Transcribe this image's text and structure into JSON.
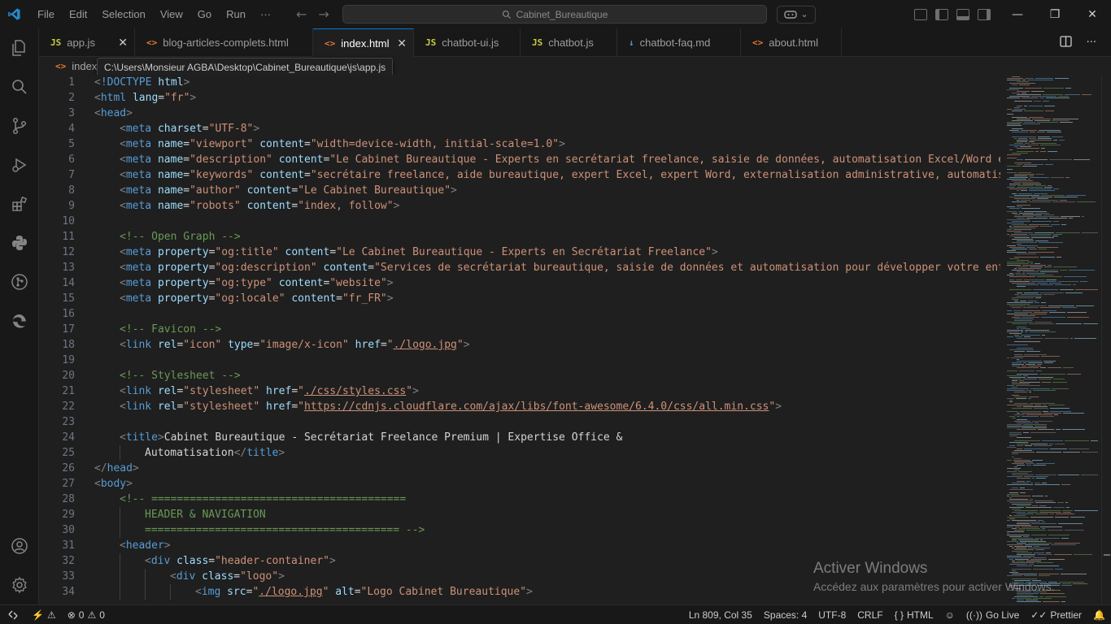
{
  "menu": [
    "File",
    "Edit",
    "Selection",
    "View",
    "Go",
    "Run",
    "···"
  ],
  "search_box": "Cabinet_Bureautique",
  "tabs": [
    {
      "label": "app.js",
      "type": "js",
      "width": 118
    },
    {
      "label": "blog-articles-complets.html",
      "type": "html",
      "width": 219
    },
    {
      "label": "index.html",
      "type": "html",
      "width": 124,
      "active": true
    },
    {
      "label": "chatbot-ui.js",
      "type": "js",
      "width": 131
    },
    {
      "label": "chatbot.js",
      "type": "js",
      "width": 119
    },
    {
      "label": "chatbot-faq.md",
      "type": "md",
      "width": 152
    },
    {
      "label": "about.html",
      "type": "html",
      "width": 124
    }
  ],
  "breadcrumb": "index.",
  "tooltip": "C:\\Users\\Monsieur AGBA\\Desktop\\Cabinet_Bureautique\\js\\app.js",
  "code_lines": [
    {
      "n": 1,
      "i": 0,
      "t": [
        [
          "b",
          "<"
        ],
        [
          "tg",
          "!DOCTYPE"
        ],
        [
          "tx",
          " "
        ],
        [
          "at",
          "html"
        ],
        [
          "b",
          ">"
        ]
      ]
    },
    {
      "n": 2,
      "i": 0,
      "t": [
        [
          "b",
          "<"
        ],
        [
          "tg",
          "html"
        ],
        [
          "tx",
          " "
        ],
        [
          "at",
          "lang"
        ],
        [
          "tx",
          "="
        ],
        [
          "st",
          "\"fr\""
        ],
        [
          "b",
          ">"
        ]
      ]
    },
    {
      "n": 3,
      "i": 0,
      "t": [
        [
          "b",
          "<"
        ],
        [
          "tg",
          "head"
        ],
        [
          "b",
          ">"
        ]
      ]
    },
    {
      "n": 4,
      "i": 1,
      "t": [
        [
          "b",
          "<"
        ],
        [
          "tg",
          "meta"
        ],
        [
          "tx",
          " "
        ],
        [
          "at",
          "charset"
        ],
        [
          "tx",
          "="
        ],
        [
          "st",
          "\"UTF-8\""
        ],
        [
          "b",
          ">"
        ]
      ]
    },
    {
      "n": 5,
      "i": 1,
      "t": [
        [
          "b",
          "<"
        ],
        [
          "tg",
          "meta"
        ],
        [
          "tx",
          " "
        ],
        [
          "at",
          "name"
        ],
        [
          "tx",
          "="
        ],
        [
          "st",
          "\"viewport\""
        ],
        [
          "tx",
          " "
        ],
        [
          "at",
          "content"
        ],
        [
          "tx",
          "="
        ],
        [
          "st",
          "\"width=device-width, initial-scale=1.0\""
        ],
        [
          "b",
          ">"
        ]
      ]
    },
    {
      "n": 6,
      "i": 1,
      "t": [
        [
          "b",
          "<"
        ],
        [
          "tg",
          "meta"
        ],
        [
          "tx",
          " "
        ],
        [
          "at",
          "name"
        ],
        [
          "tx",
          "="
        ],
        [
          "st",
          "\"description\""
        ],
        [
          "tx",
          " "
        ],
        [
          "at",
          "content"
        ],
        [
          "tx",
          "="
        ],
        [
          "st",
          "\"Le Cabinet Bureautique - Experts en secrétariat freelance, saisie de données, automatisation Excel/Word et"
        ]
      ]
    },
    {
      "n": 7,
      "i": 1,
      "t": [
        [
          "b",
          "<"
        ],
        [
          "tg",
          "meta"
        ],
        [
          "tx",
          " "
        ],
        [
          "at",
          "name"
        ],
        [
          "tx",
          "="
        ],
        [
          "st",
          "\"keywords\""
        ],
        [
          "tx",
          " "
        ],
        [
          "at",
          "content"
        ],
        [
          "tx",
          "="
        ],
        [
          "st",
          "\"secrétaire freelance, aide bureautique, expert Excel, expert Word, externalisation administrative, automatisat"
        ]
      ]
    },
    {
      "n": 8,
      "i": 1,
      "t": [
        [
          "b",
          "<"
        ],
        [
          "tg",
          "meta"
        ],
        [
          "tx",
          " "
        ],
        [
          "at",
          "name"
        ],
        [
          "tx",
          "="
        ],
        [
          "st",
          "\"author\""
        ],
        [
          "tx",
          " "
        ],
        [
          "at",
          "content"
        ],
        [
          "tx",
          "="
        ],
        [
          "st",
          "\"Le Cabinet Bureautique\""
        ],
        [
          "b",
          ">"
        ]
      ]
    },
    {
      "n": 9,
      "i": 1,
      "t": [
        [
          "b",
          "<"
        ],
        [
          "tg",
          "meta"
        ],
        [
          "tx",
          " "
        ],
        [
          "at",
          "name"
        ],
        [
          "tx",
          "="
        ],
        [
          "st",
          "\"robots\""
        ],
        [
          "tx",
          " "
        ],
        [
          "at",
          "content"
        ],
        [
          "tx",
          "="
        ],
        [
          "st",
          "\"index, follow\""
        ],
        [
          "b",
          ">"
        ]
      ]
    },
    {
      "n": 10,
      "i": 1,
      "t": []
    },
    {
      "n": 11,
      "i": 1,
      "t": [
        [
          "cm",
          "<!-- Open Graph -->"
        ]
      ]
    },
    {
      "n": 12,
      "i": 1,
      "t": [
        [
          "b",
          "<"
        ],
        [
          "tg",
          "meta"
        ],
        [
          "tx",
          " "
        ],
        [
          "at",
          "property"
        ],
        [
          "tx",
          "="
        ],
        [
          "st",
          "\"og:title\""
        ],
        [
          "tx",
          " "
        ],
        [
          "at",
          "content"
        ],
        [
          "tx",
          "="
        ],
        [
          "st",
          "\"Le Cabinet Bureautique - Experts en Secrétariat Freelance\""
        ],
        [
          "b",
          ">"
        ]
      ]
    },
    {
      "n": 13,
      "i": 1,
      "t": [
        [
          "b",
          "<"
        ],
        [
          "tg",
          "meta"
        ],
        [
          "tx",
          " "
        ],
        [
          "at",
          "property"
        ],
        [
          "tx",
          "="
        ],
        [
          "st",
          "\"og:description\""
        ],
        [
          "tx",
          " "
        ],
        [
          "at",
          "content"
        ],
        [
          "tx",
          "="
        ],
        [
          "st",
          "\"Services de secrétariat bureautique, saisie de données et automatisation pour développer votre entre"
        ]
      ]
    },
    {
      "n": 14,
      "i": 1,
      "t": [
        [
          "b",
          "<"
        ],
        [
          "tg",
          "meta"
        ],
        [
          "tx",
          " "
        ],
        [
          "at",
          "property"
        ],
        [
          "tx",
          "="
        ],
        [
          "st",
          "\"og:type\""
        ],
        [
          "tx",
          " "
        ],
        [
          "at",
          "content"
        ],
        [
          "tx",
          "="
        ],
        [
          "st",
          "\"website\""
        ],
        [
          "b",
          ">"
        ]
      ]
    },
    {
      "n": 15,
      "i": 1,
      "t": [
        [
          "b",
          "<"
        ],
        [
          "tg",
          "meta"
        ],
        [
          "tx",
          " "
        ],
        [
          "at",
          "property"
        ],
        [
          "tx",
          "="
        ],
        [
          "st",
          "\"og:locale\""
        ],
        [
          "tx",
          " "
        ],
        [
          "at",
          "content"
        ],
        [
          "tx",
          "="
        ],
        [
          "st",
          "\"fr_FR\""
        ],
        [
          "b",
          ">"
        ]
      ]
    },
    {
      "n": 16,
      "i": 1,
      "t": []
    },
    {
      "n": 17,
      "i": 1,
      "t": [
        [
          "cm",
          "<!-- Favicon -->"
        ]
      ]
    },
    {
      "n": 18,
      "i": 1,
      "t": [
        [
          "b",
          "<"
        ],
        [
          "tg",
          "link"
        ],
        [
          "tx",
          " "
        ],
        [
          "at",
          "rel"
        ],
        [
          "tx",
          "="
        ],
        [
          "st",
          "\"icon\""
        ],
        [
          "tx",
          " "
        ],
        [
          "at",
          "type"
        ],
        [
          "tx",
          "="
        ],
        [
          "st",
          "\"image/x-icon\""
        ],
        [
          "tx",
          " "
        ],
        [
          "at",
          "href"
        ],
        [
          "tx",
          "="
        ],
        [
          "st",
          "\""
        ],
        [
          "stu",
          "./logo.jpg"
        ],
        [
          "st",
          "\""
        ],
        [
          "b",
          ">"
        ]
      ]
    },
    {
      "n": 19,
      "i": 1,
      "t": []
    },
    {
      "n": 20,
      "i": 1,
      "t": [
        [
          "cm",
          "<!-- Stylesheet -->"
        ]
      ]
    },
    {
      "n": 21,
      "i": 1,
      "t": [
        [
          "b",
          "<"
        ],
        [
          "tg",
          "link"
        ],
        [
          "tx",
          " "
        ],
        [
          "at",
          "rel"
        ],
        [
          "tx",
          "="
        ],
        [
          "st",
          "\"stylesheet\""
        ],
        [
          "tx",
          " "
        ],
        [
          "at",
          "href"
        ],
        [
          "tx",
          "="
        ],
        [
          "st",
          "\""
        ],
        [
          "stu",
          "./css/styles.css"
        ],
        [
          "st",
          "\""
        ],
        [
          "b",
          ">"
        ]
      ]
    },
    {
      "n": 22,
      "i": 1,
      "t": [
        [
          "b",
          "<"
        ],
        [
          "tg",
          "link"
        ],
        [
          "tx",
          " "
        ],
        [
          "at",
          "rel"
        ],
        [
          "tx",
          "="
        ],
        [
          "st",
          "\"stylesheet\""
        ],
        [
          "tx",
          " "
        ],
        [
          "at",
          "href"
        ],
        [
          "tx",
          "="
        ],
        [
          "st",
          "\""
        ],
        [
          "stu",
          "https://cdnjs.cloudflare.com/ajax/libs/font-awesome/6.4.0/css/all.min.css"
        ],
        [
          "st",
          "\""
        ],
        [
          "b",
          ">"
        ]
      ]
    },
    {
      "n": 23,
      "i": 1,
      "t": []
    },
    {
      "n": 24,
      "i": 1,
      "t": [
        [
          "b",
          "<"
        ],
        [
          "tg",
          "title"
        ],
        [
          "b",
          ">"
        ],
        [
          "tx",
          "Cabinet Bureautique - Secrétariat Freelance Premium | Expertise Office &"
        ]
      ]
    },
    {
      "n": 25,
      "i": 2,
      "t": [
        [
          "tx",
          "Automatisation"
        ],
        [
          "b",
          "</"
        ],
        [
          "tg",
          "title"
        ],
        [
          "b",
          ">"
        ]
      ]
    },
    {
      "n": 26,
      "i": 0,
      "t": [
        [
          "b",
          "</"
        ],
        [
          "tg",
          "head"
        ],
        [
          "b",
          ">"
        ]
      ]
    },
    {
      "n": 27,
      "i": 0,
      "t": [
        [
          "b",
          "<"
        ],
        [
          "tg",
          "body"
        ],
        [
          "b",
          ">"
        ]
      ]
    },
    {
      "n": 28,
      "i": 1,
      "t": [
        [
          "cm",
          "<!-- ========================================"
        ]
      ]
    },
    {
      "n": 29,
      "i": 2,
      "t": [
        [
          "cm",
          "HEADER & NAVIGATION"
        ]
      ]
    },
    {
      "n": 30,
      "i": 2,
      "t": [
        [
          "cm",
          "======================================== -->"
        ]
      ]
    },
    {
      "n": 31,
      "i": 1,
      "t": [
        [
          "b",
          "<"
        ],
        [
          "tg",
          "header"
        ],
        [
          "b",
          ">"
        ]
      ]
    },
    {
      "n": 32,
      "i": 2,
      "t": [
        [
          "b",
          "<"
        ],
        [
          "tg",
          "div"
        ],
        [
          "tx",
          " "
        ],
        [
          "at",
          "class"
        ],
        [
          "tx",
          "="
        ],
        [
          "st",
          "\"header-container\""
        ],
        [
          "b",
          ">"
        ]
      ]
    },
    {
      "n": 33,
      "i": 3,
      "t": [
        [
          "b",
          "<"
        ],
        [
          "tg",
          "div"
        ],
        [
          "tx",
          " "
        ],
        [
          "at",
          "class"
        ],
        [
          "tx",
          "="
        ],
        [
          "st",
          "\"logo\""
        ],
        [
          "b",
          ">"
        ]
      ]
    },
    {
      "n": 34,
      "i": 4,
      "t": [
        [
          "b",
          "<"
        ],
        [
          "tg",
          "img"
        ],
        [
          "tx",
          " "
        ],
        [
          "at",
          "src"
        ],
        [
          "tx",
          "="
        ],
        [
          "st",
          "\""
        ],
        [
          "stu",
          "./logo.jpg"
        ],
        [
          "st",
          "\""
        ],
        [
          "tx",
          " "
        ],
        [
          "at",
          "alt"
        ],
        [
          "tx",
          "="
        ],
        [
          "st",
          "\"Logo Cabinet Bureautique\""
        ],
        [
          "b",
          ">"
        ]
      ]
    }
  ],
  "watermark": {
    "title": "Activer Windows",
    "subtitle": "Accédez aux paramètres pour activer Windows."
  },
  "status": {
    "errors": "0",
    "warnings": "0",
    "position": "Ln 809, Col 35",
    "spaces": "Spaces: 4",
    "encoding": "UTF-8",
    "eol": "CRLF",
    "language": "HTML",
    "golive": "Go Live",
    "prettier": "Prettier"
  },
  "colors": {
    "accent": "#0078d4",
    "editor_bg": "#1f1f1f",
    "chrome_bg": "#181818"
  }
}
